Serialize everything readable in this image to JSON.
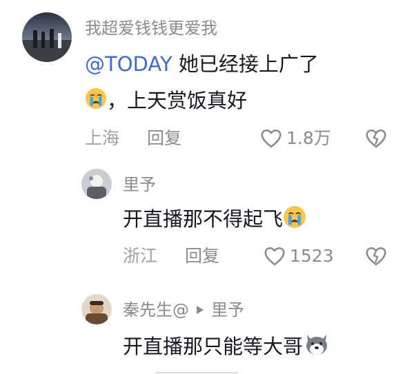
{
  "comments": [
    {
      "username": "我超爱钱钱更爱我",
      "mention": "@TODAY",
      "text_line1": " 她已经接上广了",
      "text_line2": "，上天赏饭真好",
      "location": "上海",
      "reply_label": "回复",
      "likes": "1.8万",
      "icons": [
        "avatar-image",
        "crying-face-emoji",
        "heart-icon",
        "broken-heart-icon"
      ]
    },
    {
      "username": "里予",
      "text": "开直播那不得起飞",
      "location": "浙江",
      "reply_label": "回复",
      "likes": "1523",
      "icons": [
        "avatar-image",
        "crying-face-emoji",
        "heart-icon",
        "broken-heart-icon"
      ]
    },
    {
      "username": "秦先生@",
      "reply_to": "里予",
      "text": "开直播那只能等大哥",
      "icons": [
        "avatar-image",
        "play-triangle-icon",
        "dog-face-emoji"
      ]
    }
  ]
}
